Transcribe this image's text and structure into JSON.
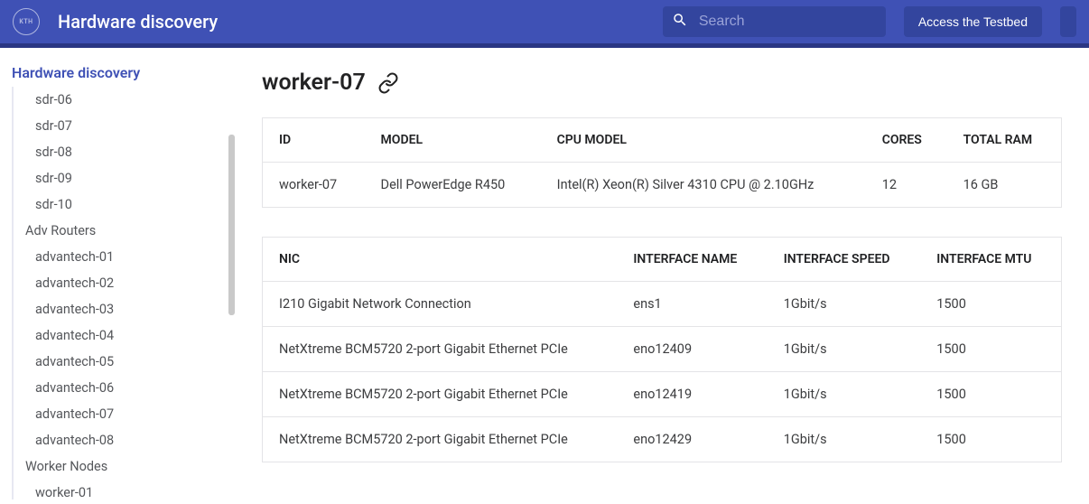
{
  "header": {
    "logo_text": "KTH",
    "title": "Hardware discovery",
    "search_placeholder": "Search",
    "testbed_button": "Access the Testbed"
  },
  "sidebar": {
    "heading": "Hardware discovery",
    "items": [
      {
        "label": "sdr-06",
        "depth": 2
      },
      {
        "label": "sdr-07",
        "depth": 2
      },
      {
        "label": "sdr-08",
        "depth": 2
      },
      {
        "label": "sdr-09",
        "depth": 2
      },
      {
        "label": "sdr-10",
        "depth": 2
      }
    ],
    "group_adv": {
      "label": "Adv Routers"
    },
    "adv_items": [
      {
        "label": "advantech-01"
      },
      {
        "label": "advantech-02"
      },
      {
        "label": "advantech-03"
      },
      {
        "label": "advantech-04"
      },
      {
        "label": "advantech-05"
      },
      {
        "label": "advantech-06"
      },
      {
        "label": "advantech-07"
      },
      {
        "label": "advantech-08"
      }
    ],
    "group_worker": {
      "label": "Worker Nodes"
    },
    "worker_items": [
      {
        "label": "worker-01"
      }
    ]
  },
  "main": {
    "title": "worker-07",
    "summary_table": {
      "headers": [
        "ID",
        "MODEL",
        "CPU MODEL",
        "CORES",
        "TOTAL RAM"
      ],
      "row": {
        "id": "worker-07",
        "model": "Dell PowerEdge R450",
        "cpu_model": "Intel(R) Xeon(R) Silver 4310 CPU @ 2.10GHz",
        "cores": "12",
        "total_ram": "16 GB"
      }
    },
    "nic_table": {
      "headers": [
        "NIC",
        "INTERFACE NAME",
        "INTERFACE SPEED",
        "INTERFACE MTU"
      ],
      "rows": [
        {
          "nic": "I210 Gigabit Network Connection",
          "if_name": "ens1",
          "if_speed": "1Gbit/s",
          "if_mtu": "1500"
        },
        {
          "nic": "NetXtreme BCM5720 2-port Gigabit Ethernet PCIe",
          "if_name": "eno12409",
          "if_speed": "1Gbit/s",
          "if_mtu": "1500"
        },
        {
          "nic": "NetXtreme BCM5720 2-port Gigabit Ethernet PCIe",
          "if_name": "eno12419",
          "if_speed": "1Gbit/s",
          "if_mtu": "1500"
        },
        {
          "nic": "NetXtreme BCM5720 2-port Gigabit Ethernet PCIe",
          "if_name": "eno12429",
          "if_speed": "1Gbit/s",
          "if_mtu": "1500"
        }
      ]
    }
  }
}
